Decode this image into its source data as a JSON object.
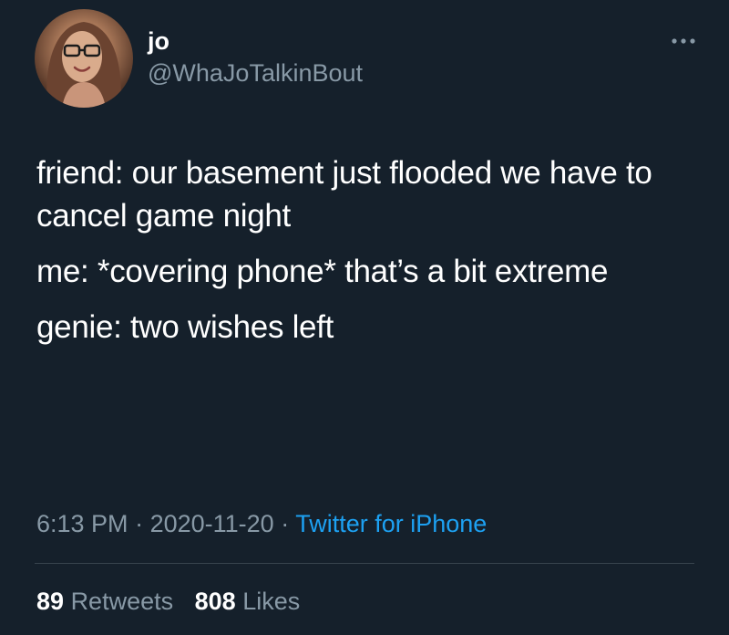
{
  "user": {
    "display_name": "jo",
    "handle": "@WhaJoTalkinBout"
  },
  "tweet": {
    "paragraphs": [
      "friend: our basement just flooded we have to cancel game night",
      "me: *covering phone* that’s a bit extreme",
      "genie: two wishes left"
    ],
    "time": "6:13 PM",
    "date": "2020-11-20",
    "separator": "·",
    "source": "Twitter for iPhone"
  },
  "stats": {
    "retweets_count": "89",
    "retweets_label": "Retweets",
    "likes_count": "808",
    "likes_label": "Likes"
  },
  "icons": {
    "more": "more-options-icon"
  },
  "colors": {
    "background": "#15202b",
    "text_primary": "#ffffff",
    "text_secondary": "#8899a6",
    "link": "#1da1f2",
    "divider": "#38444d"
  }
}
